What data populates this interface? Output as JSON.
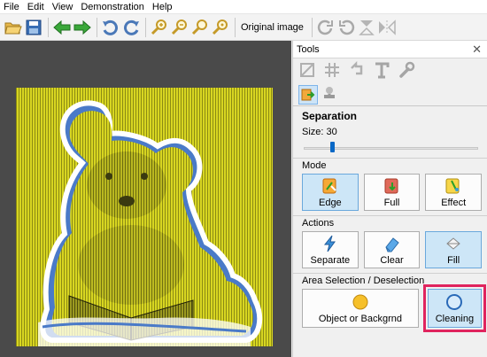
{
  "menu": [
    "File",
    "Edit",
    "View",
    "Demonstration",
    "Help"
  ],
  "toolbar": {
    "original_image_label": "Original image"
  },
  "tools": {
    "title": "Tools",
    "close": "✕",
    "separation": {
      "title": "Separation",
      "size_label": "Size: 30",
      "size_value": 30
    },
    "mode": {
      "title": "Mode",
      "buttons": [
        "Edge",
        "Full",
        "Effect"
      ],
      "active": "Edge"
    },
    "actions": {
      "title": "Actions",
      "buttons": [
        "Separate",
        "Clear",
        "Fill"
      ],
      "active": "Fill"
    },
    "area_selection": {
      "title": "Area Selection / Deselection",
      "object_button": "Object or Backgrnd",
      "cleaning_button": "Cleaning"
    }
  },
  "colors": {
    "highlight": "#e0245e",
    "active_button": "#cde6f7",
    "canvas_bg": "#4a4a4a",
    "image_yellow": "#d8d621"
  }
}
